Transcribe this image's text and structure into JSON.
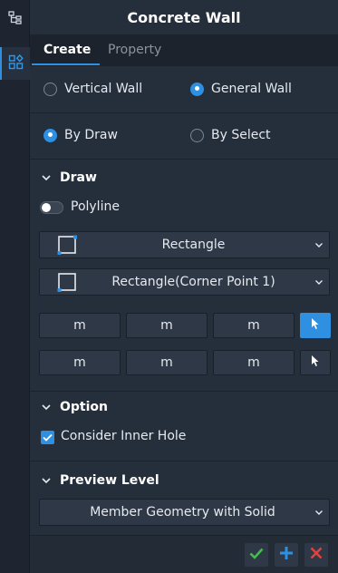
{
  "toolbar": {
    "items": [
      {
        "icon": "tree-icon",
        "active": false
      },
      {
        "icon": "grid-shapes-icon",
        "active": true
      }
    ]
  },
  "panel": {
    "title": "Concrete Wall",
    "tabs": [
      {
        "label": "Create",
        "active": true
      },
      {
        "label": "Property",
        "active": false
      }
    ]
  },
  "wall_type": {
    "options": [
      {
        "label": "Vertical Wall",
        "selected": false
      },
      {
        "label": "General Wall",
        "selected": true
      }
    ]
  },
  "method": {
    "options": [
      {
        "label": "By Draw",
        "selected": true
      },
      {
        "label": "By Select",
        "selected": false
      }
    ]
  },
  "draw": {
    "header": "Draw",
    "polyline_label": "Polyline",
    "polyline_on": false,
    "shape_value": "Rectangle",
    "point_value": "Rectangle(Corner Point 1)",
    "row1": [
      "m",
      "m",
      "m"
    ],
    "row2": [
      "m",
      "m",
      "m"
    ]
  },
  "option": {
    "header": "Option",
    "consider_inner_hole_label": "Consider Inner Hole",
    "consider_inner_hole_checked": true
  },
  "preview": {
    "header": "Preview Level",
    "value": "Member Geometry with Solid"
  },
  "colors": {
    "accent": "#2f8fe0",
    "confirm": "#3fbf4a",
    "add": "#2f8fe0",
    "cancel": "#e0423c"
  }
}
